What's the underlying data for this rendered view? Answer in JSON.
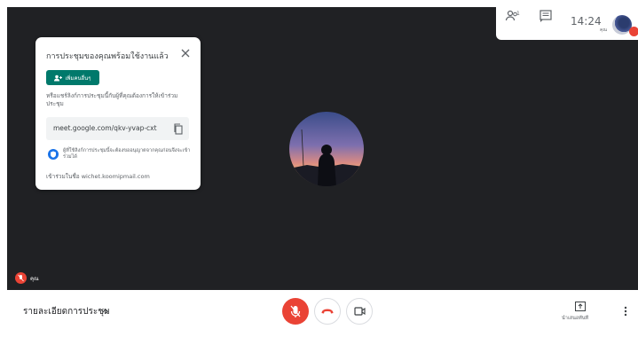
{
  "header": {
    "participants_count": "1",
    "time": "14:24",
    "self_label": "คุณ"
  },
  "icons": {
    "people": "people-icon",
    "chat": "chat-icon",
    "close": "close-icon",
    "add_person": "add-person-icon",
    "copy": "copy-icon",
    "shield": "shield-icon",
    "mic_off": "mic-off-icon",
    "call_end": "call-end-icon",
    "camera": "camera-icon",
    "present": "present-icon",
    "more": "more-vert-icon",
    "chevron": "chevron-up-icon"
  },
  "card": {
    "title": "การประชุมของคุณพร้อมใช้งานแล้ว",
    "add_button": "เพิ่มคนอื่นๆ",
    "description": "หรือแชร์ลิงก์การประชุมนี้กับผู้ที่คุณต้องการให้เข้าร่วมประชุม",
    "link": "meet.google.com/qkv-yvap-cxt",
    "info": "ผู้ที่ใช้ลิงก์การประชุมนี้จะต้องขออนุญาตจากคุณก่อนจึงจะเข้าร่วมได้",
    "joined_as": "เข้าร่วมในชื่อ wichet.koomipmail.com"
  },
  "tile": {
    "name": "คุณ"
  },
  "bottom": {
    "details_label": "รายละเอียดการประชุม",
    "present_label": "นำเสนอทันที"
  },
  "colors": {
    "background": "#202124",
    "accent_green": "#00796b",
    "red": "#ea4335",
    "blue": "#1a73e8"
  }
}
